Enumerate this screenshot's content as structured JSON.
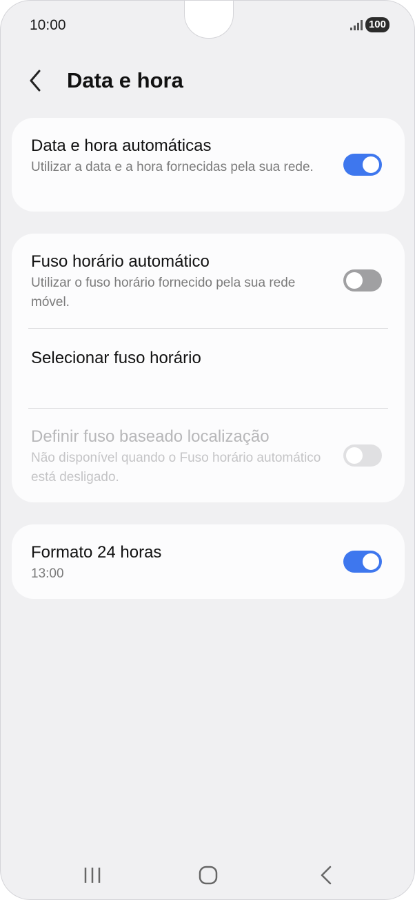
{
  "status_bar": {
    "time": "10:00",
    "battery": "100"
  },
  "header": {
    "title": "Data e hora",
    "back_icon": "chevron-left-icon"
  },
  "settings": {
    "auto_datetime": {
      "title": "Data e hora automáticas",
      "subtitle": "Utilizar a data e a hora fornecidas pela sua rede.",
      "enabled": true
    },
    "auto_timezone": {
      "title": "Fuso horário automático",
      "subtitle": "Utilizar o fuso horário fornecido pela sua rede móvel.",
      "enabled": false
    },
    "select_timezone": {
      "title": "Selecionar fuso horário"
    },
    "location_timezone": {
      "title": "Definir fuso baseado localização",
      "subtitle": "Não disponível quando o Fuso horário automático está desligado.",
      "enabled": false,
      "disabled": true
    },
    "format_24h": {
      "title": "Formato 24 horas",
      "subtitle": "13:00",
      "enabled": true
    }
  },
  "navigation": {
    "recents_icon": "recent-apps-icon",
    "home_icon": "home-icon",
    "back_icon": "back-icon"
  },
  "colors": {
    "toggle_on": "#3e77ee",
    "toggle_off": "#a0a0a2",
    "background": "#f0f0f2",
    "card": "#fcfcfd"
  }
}
